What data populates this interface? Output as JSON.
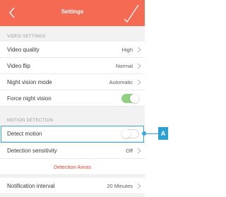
{
  "nav": {
    "title": "Settings",
    "bg_color": "#f56a52",
    "back_icon": "chevron-left-icon",
    "confirm_icon": "checkmark-icon"
  },
  "video_settings": {
    "header": "VIDEO SETTINGS",
    "rows": [
      {
        "label": "Video quality",
        "value": "High"
      },
      {
        "label": "Video flip",
        "value": "Normal"
      },
      {
        "label": "Night vision mode",
        "value": "Automatic"
      },
      {
        "label": "Force night vision",
        "toggle": "on"
      }
    ]
  },
  "motion_detection": {
    "header": "MOTION DETECTION",
    "detect_motion": {
      "label": "Detect motion",
      "toggle": "off"
    },
    "sensitivity": {
      "label": "Detection sensitivity",
      "value": "Off"
    },
    "areas_link": "Detection Areas",
    "interval": {
      "label": "Notification interval",
      "value": "20 Minutes"
    }
  },
  "callout": {
    "label": "A",
    "color": "#36a9d9"
  },
  "colors": {
    "toggle_on": "#8fd181",
    "link": "#f2462f"
  }
}
